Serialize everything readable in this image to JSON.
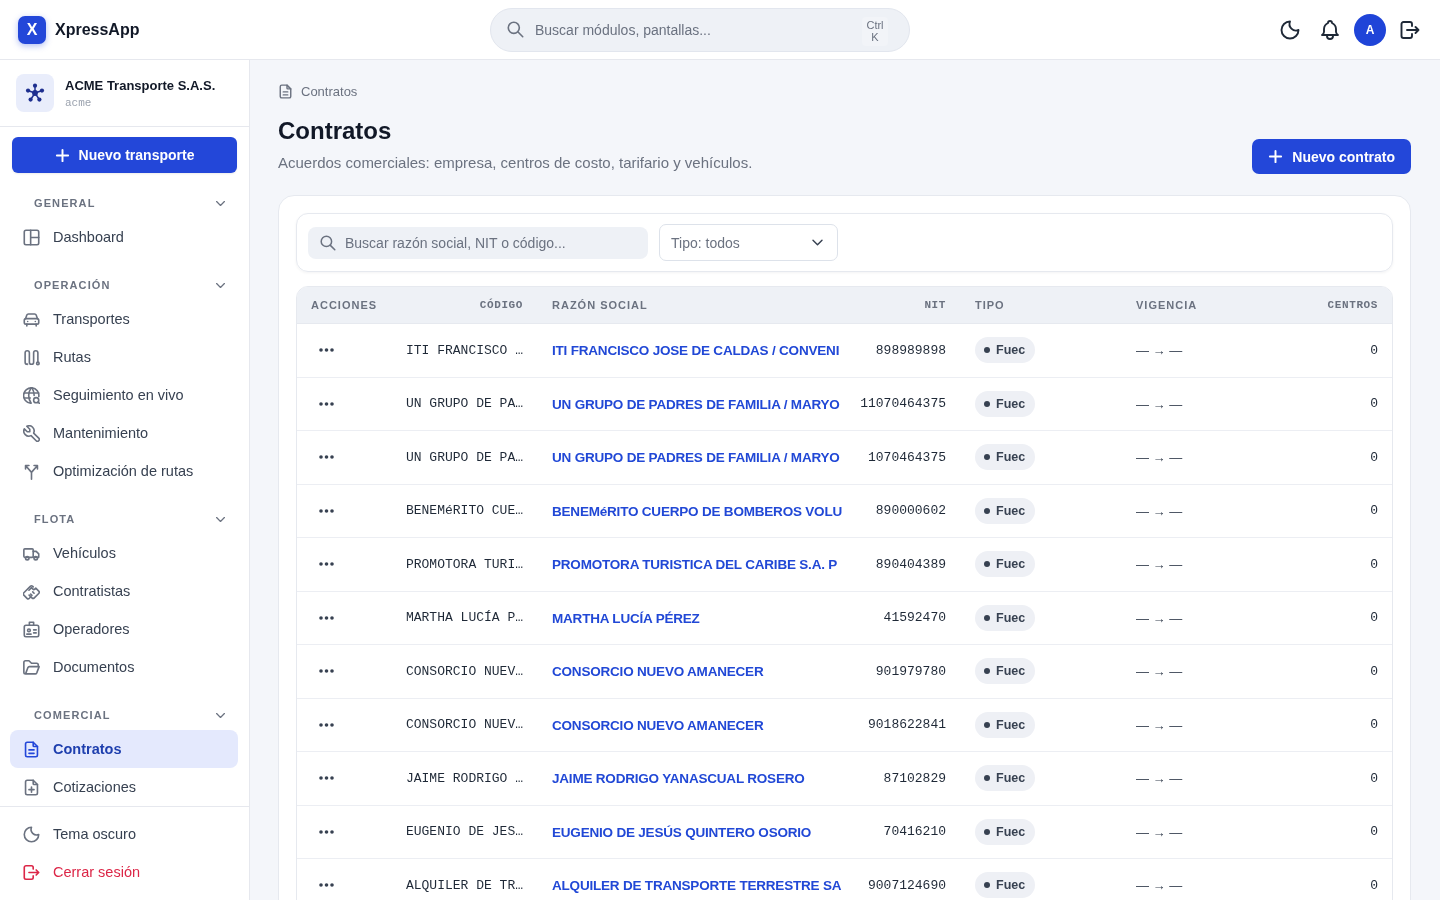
{
  "app": {
    "logo": "X",
    "name": "XpressApp"
  },
  "global_search": {
    "placeholder": "Buscar módulos, pantallas...",
    "shortcut": "Ctrl K"
  },
  "user": {
    "avatar": "A"
  },
  "organization": {
    "name": "ACME Transporte S.A.S.",
    "slug": "acme"
  },
  "sidebar": {
    "new_button": "Nuevo transporte",
    "sections": [
      {
        "title": "GENERAL",
        "expanded": true,
        "items": [
          {
            "label": "Dashboard",
            "selected": false
          }
        ]
      },
      {
        "title": "OPERACIÓN",
        "expanded": true,
        "items": [
          {
            "label": "Transportes",
            "selected": false
          },
          {
            "label": "Rutas",
            "selected": false
          },
          {
            "label": "Seguimiento en vivo",
            "selected": false
          },
          {
            "label": "Mantenimiento",
            "selected": false
          },
          {
            "label": "Optimización de rutas",
            "selected": false
          }
        ]
      },
      {
        "title": "FLOTA",
        "expanded": true,
        "items": [
          {
            "label": "Vehículos",
            "selected": false
          },
          {
            "label": "Contratistas",
            "selected": false
          },
          {
            "label": "Operadores",
            "selected": false
          },
          {
            "label": "Documentos",
            "selected": false
          }
        ]
      },
      {
        "title": "COMERCIAL",
        "expanded": true,
        "items": [
          {
            "label": "Contratos",
            "selected": true
          },
          {
            "label": "Cotizaciones",
            "selected": false
          }
        ]
      }
    ],
    "footer": [
      {
        "kind": "theme",
        "label": "Tema oscuro"
      },
      {
        "kind": "logout",
        "label": "Cerrar sesión"
      }
    ]
  },
  "breadcrumb": [
    {
      "label": "Contratos"
    }
  ],
  "header": {
    "title": "Contratos",
    "subtitle": "Acuerdos comerciales: empresa, centros de costo, tarifario y vehículos.",
    "new_button": "Nuevo contrato"
  },
  "filters": {
    "search": {
      "placeholder": "Buscar razón social, NIT o código..."
    },
    "type_select": {
      "value": "Tipo: todos"
    }
  },
  "table": {
    "columns": [
      "ACCIONES",
      "CÓDIGO",
      "RAZÓN SOCIAL",
      "NIT",
      "TIPO",
      "VIGENCIA",
      "CENTROS"
    ],
    "rows": [
      {
        "code": "ITI FRANCISCO …",
        "name": "ITI FRANCISCO JOSE DE CALDAS / CONVENI",
        "nit": "898989898",
        "type": "Fuec",
        "validity": "— → —",
        "centers": "0"
      },
      {
        "code": "UN GRUPO DE PA…",
        "name": "UN GRUPO DE PADRES DE FAMILIA / MARYO",
        "nit": "11070464375",
        "type": "Fuec",
        "validity": "— → —",
        "centers": "0"
      },
      {
        "code": "UN GRUPO DE PA…",
        "name": "UN GRUPO DE PADRES DE FAMILIA / MARYO",
        "nit": "1070464375",
        "type": "Fuec",
        "validity": "— → —",
        "centers": "0"
      },
      {
        "code": "BENEMéRITO CUE…",
        "name": "BENEMéRITO CUERPO DE BOMBEROS VOLU",
        "nit": "890000602",
        "type": "Fuec",
        "validity": "— → —",
        "centers": "0"
      },
      {
        "code": "PROMOTORA TURI…",
        "name": "PROMOTORA TURISTICA DEL CARIBE S.A. P",
        "nit": "890404389",
        "type": "Fuec",
        "validity": "— → —",
        "centers": "0"
      },
      {
        "code": "MARTHA LUCÍA P…",
        "name": "MARTHA LUCÍA PÉREZ",
        "nit": "41592470",
        "type": "Fuec",
        "validity": "— → —",
        "centers": "0"
      },
      {
        "code": "CONSORCIO NUEV…",
        "name": "CONSORCIO NUEVO AMANECER",
        "nit": "901979780",
        "type": "Fuec",
        "validity": "— → —",
        "centers": "0"
      },
      {
        "code": "CONSORCIO NUEV…",
        "name": "CONSORCIO NUEVO AMANECER",
        "nit": "9018622841",
        "type": "Fuec",
        "validity": "— → —",
        "centers": "0"
      },
      {
        "code": "JAIME RODRIGO …",
        "name": "JAIME RODRIGO YANASCUAL ROSERO",
        "nit": "87102829",
        "type": "Fuec",
        "validity": "— → —",
        "centers": "0"
      },
      {
        "code": "EUGENIO DE JES…",
        "name": "EUGENIO DE JESÚS QUINTERO OSORIO",
        "nit": "70416210",
        "type": "Fuec",
        "validity": "— → —",
        "centers": "0"
      },
      {
        "code": "ALQUILER DE TR…",
        "name": "ALQUILER DE TRANSPORTE TERRESTRE SA",
        "nit": "9007124690",
        "type": "Fuec",
        "validity": "— → —",
        "centers": "0"
      }
    ]
  }
}
